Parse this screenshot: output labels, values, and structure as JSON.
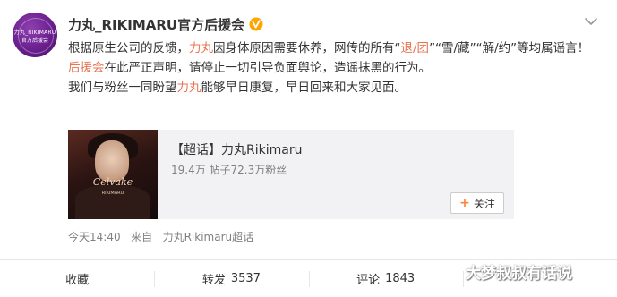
{
  "avatar": {
    "top_text": "力丸_RIKIMARU",
    "bottom_text": "官方后援会"
  },
  "header": {
    "username": "力丸_RIKIMARU官方后援会"
  },
  "body": {
    "p1_a": "根据原生公司的反馈，",
    "p1_b": "力丸",
    "p1_c": "因身体原因需要休养，网传的所有“",
    "p1_d": "退/团",
    "p1_e": "”“雪/藏”“解/约”等均属谣言！",
    "p2_a": "后援会",
    "p2_b": "在此严正声明，请停止一切引导负面舆论，造谣抹黑的行为。",
    "p3_a": "我们与粉丝一同盼望",
    "p3_b": "力丸",
    "p3_c": "能够早日康复，早日回来和大家见面。"
  },
  "share_card": {
    "thumb_script": "Celvake",
    "thumb_small": "RIKIMARU",
    "title": "【超话】力丸Rikimaru",
    "stats": "19.4万 帖子72.3万粉丝",
    "follow_label": "关注"
  },
  "meta": {
    "time": "今天14:40",
    "source_prefix": "来自",
    "source": "力丸Rikimaru超话"
  },
  "actions": {
    "favorite_label": "收藏",
    "repost_label": "转发",
    "repost_count": "3537",
    "comment_label": "评论",
    "comment_count": "1843",
    "like_label": "",
    "like_count": ""
  },
  "watermark": "大梦叔叔有话说",
  "colors": {
    "accent": "#eb7350",
    "verified": "#ffa500",
    "muted": "#808080"
  },
  "icons": {
    "verified": "verified-v-icon",
    "menu": "chevron-down-icon",
    "follow": "plus-icon"
  }
}
